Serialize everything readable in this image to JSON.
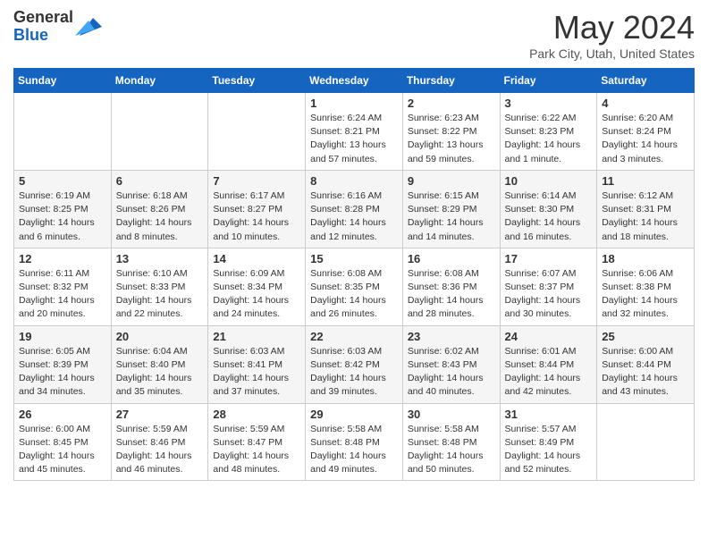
{
  "logo": {
    "general": "General",
    "blue": "Blue"
  },
  "title": "May 2024",
  "location": "Park City, Utah, United States",
  "weekdays": [
    "Sunday",
    "Monday",
    "Tuesday",
    "Wednesday",
    "Thursday",
    "Friday",
    "Saturday"
  ],
  "weeks": [
    [
      {
        "day": "",
        "info": ""
      },
      {
        "day": "",
        "info": ""
      },
      {
        "day": "",
        "info": ""
      },
      {
        "day": "1",
        "info": "Sunrise: 6:24 AM\nSunset: 8:21 PM\nDaylight: 13 hours\nand 57 minutes."
      },
      {
        "day": "2",
        "info": "Sunrise: 6:23 AM\nSunset: 8:22 PM\nDaylight: 13 hours\nand 59 minutes."
      },
      {
        "day": "3",
        "info": "Sunrise: 6:22 AM\nSunset: 8:23 PM\nDaylight: 14 hours\nand 1 minute."
      },
      {
        "day": "4",
        "info": "Sunrise: 6:20 AM\nSunset: 8:24 PM\nDaylight: 14 hours\nand 3 minutes."
      }
    ],
    [
      {
        "day": "5",
        "info": "Sunrise: 6:19 AM\nSunset: 8:25 PM\nDaylight: 14 hours\nand 6 minutes."
      },
      {
        "day": "6",
        "info": "Sunrise: 6:18 AM\nSunset: 8:26 PM\nDaylight: 14 hours\nand 8 minutes."
      },
      {
        "day": "7",
        "info": "Sunrise: 6:17 AM\nSunset: 8:27 PM\nDaylight: 14 hours\nand 10 minutes."
      },
      {
        "day": "8",
        "info": "Sunrise: 6:16 AM\nSunset: 8:28 PM\nDaylight: 14 hours\nand 12 minutes."
      },
      {
        "day": "9",
        "info": "Sunrise: 6:15 AM\nSunset: 8:29 PM\nDaylight: 14 hours\nand 14 minutes."
      },
      {
        "day": "10",
        "info": "Sunrise: 6:14 AM\nSunset: 8:30 PM\nDaylight: 14 hours\nand 16 minutes."
      },
      {
        "day": "11",
        "info": "Sunrise: 6:12 AM\nSunset: 8:31 PM\nDaylight: 14 hours\nand 18 minutes."
      }
    ],
    [
      {
        "day": "12",
        "info": "Sunrise: 6:11 AM\nSunset: 8:32 PM\nDaylight: 14 hours\nand 20 minutes."
      },
      {
        "day": "13",
        "info": "Sunrise: 6:10 AM\nSunset: 8:33 PM\nDaylight: 14 hours\nand 22 minutes."
      },
      {
        "day": "14",
        "info": "Sunrise: 6:09 AM\nSunset: 8:34 PM\nDaylight: 14 hours\nand 24 minutes."
      },
      {
        "day": "15",
        "info": "Sunrise: 6:08 AM\nSunset: 8:35 PM\nDaylight: 14 hours\nand 26 minutes."
      },
      {
        "day": "16",
        "info": "Sunrise: 6:08 AM\nSunset: 8:36 PM\nDaylight: 14 hours\nand 28 minutes."
      },
      {
        "day": "17",
        "info": "Sunrise: 6:07 AM\nSunset: 8:37 PM\nDaylight: 14 hours\nand 30 minutes."
      },
      {
        "day": "18",
        "info": "Sunrise: 6:06 AM\nSunset: 8:38 PM\nDaylight: 14 hours\nand 32 minutes."
      }
    ],
    [
      {
        "day": "19",
        "info": "Sunrise: 6:05 AM\nSunset: 8:39 PM\nDaylight: 14 hours\nand 34 minutes."
      },
      {
        "day": "20",
        "info": "Sunrise: 6:04 AM\nSunset: 8:40 PM\nDaylight: 14 hours\nand 35 minutes."
      },
      {
        "day": "21",
        "info": "Sunrise: 6:03 AM\nSunset: 8:41 PM\nDaylight: 14 hours\nand 37 minutes."
      },
      {
        "day": "22",
        "info": "Sunrise: 6:03 AM\nSunset: 8:42 PM\nDaylight: 14 hours\nand 39 minutes."
      },
      {
        "day": "23",
        "info": "Sunrise: 6:02 AM\nSunset: 8:43 PM\nDaylight: 14 hours\nand 40 minutes."
      },
      {
        "day": "24",
        "info": "Sunrise: 6:01 AM\nSunset: 8:44 PM\nDaylight: 14 hours\nand 42 minutes."
      },
      {
        "day": "25",
        "info": "Sunrise: 6:00 AM\nSunset: 8:44 PM\nDaylight: 14 hours\nand 43 minutes."
      }
    ],
    [
      {
        "day": "26",
        "info": "Sunrise: 6:00 AM\nSunset: 8:45 PM\nDaylight: 14 hours\nand 45 minutes."
      },
      {
        "day": "27",
        "info": "Sunrise: 5:59 AM\nSunset: 8:46 PM\nDaylight: 14 hours\nand 46 minutes."
      },
      {
        "day": "28",
        "info": "Sunrise: 5:59 AM\nSunset: 8:47 PM\nDaylight: 14 hours\nand 48 minutes."
      },
      {
        "day": "29",
        "info": "Sunrise: 5:58 AM\nSunset: 8:48 PM\nDaylight: 14 hours\nand 49 minutes."
      },
      {
        "day": "30",
        "info": "Sunrise: 5:58 AM\nSunset: 8:48 PM\nDaylight: 14 hours\nand 50 minutes."
      },
      {
        "day": "31",
        "info": "Sunrise: 5:57 AM\nSunset: 8:49 PM\nDaylight: 14 hours\nand 52 minutes."
      },
      {
        "day": "",
        "info": ""
      }
    ]
  ]
}
